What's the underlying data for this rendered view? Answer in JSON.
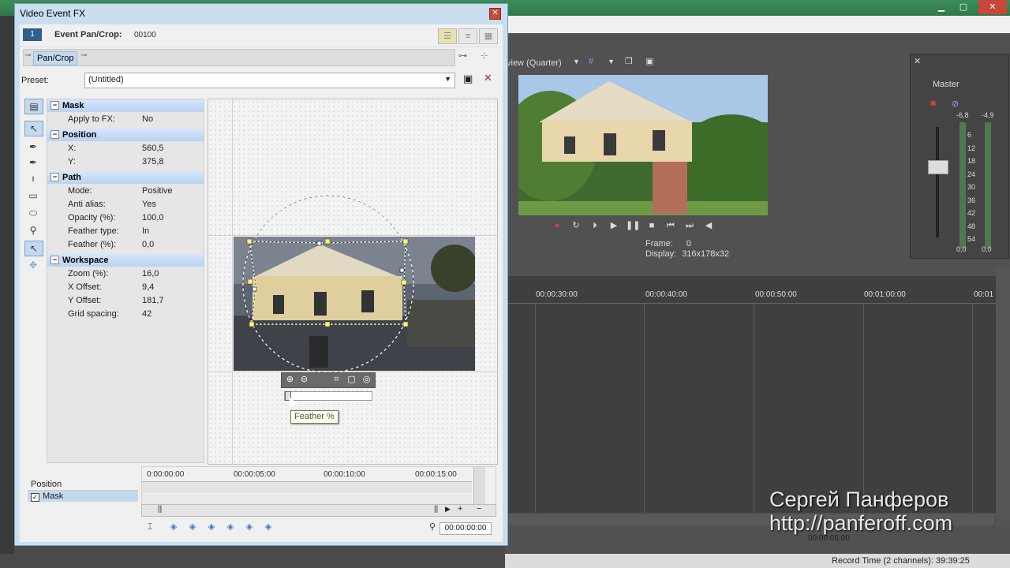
{
  "dialog": {
    "title": "Video Event FX",
    "fx": {
      "chip": "1",
      "name": "Event Pan/Crop:",
      "code": "00100"
    },
    "chain": {
      "item": "Pan/Crop"
    },
    "preset": {
      "label": "Preset:",
      "value": "(Untitled)"
    }
  },
  "properties": {
    "sections": [
      {
        "title": "Mask",
        "rows": [
          {
            "k": "Apply to FX:",
            "v": "No"
          }
        ]
      },
      {
        "title": "Position",
        "rows": [
          {
            "k": "X:",
            "v": "560,5"
          },
          {
            "k": "Y:",
            "v": "375,8"
          }
        ]
      },
      {
        "title": "Path",
        "rows": [
          {
            "k": "Mode:",
            "v": "Positive"
          },
          {
            "k": "Anti alias:",
            "v": "Yes"
          },
          {
            "k": "Opacity (%):",
            "v": "100,0"
          },
          {
            "k": "Feather type:",
            "v": "In"
          },
          {
            "k": "Feather (%):",
            "v": "0,0"
          }
        ]
      },
      {
        "title": "Workspace",
        "rows": [
          {
            "k": "Zoom (%):",
            "v": "16,0"
          },
          {
            "k": "X Offset:",
            "v": "9,4"
          },
          {
            "k": "Y Offset:",
            "v": "181,7"
          },
          {
            "k": "Grid spacing:",
            "v": "42"
          }
        ]
      }
    ]
  },
  "workspace": {
    "tooltip": "Feather %",
    "feather_value": 0
  },
  "keyframes": {
    "tracks": [
      "Position",
      "Mask"
    ],
    "ruler": [
      "0:00:00:00",
      "00:00:05:00",
      "00:00:10:00",
      "00:00:15:00"
    ],
    "time": "00:00:00:00"
  },
  "host": {
    "preview_mode": "view (Quarter)",
    "frame_label": "Frame:",
    "frame_value": "0",
    "display_label": "Display:",
    "display_value": "316x178x32",
    "master_label": "Master",
    "meter_scale": [
      "6",
      "12",
      "18",
      "24",
      "30",
      "36",
      "42",
      "48",
      "54"
    ],
    "meter_peaks": [
      "-6,8",
      "-4,9"
    ],
    "meter_levels": [
      "0,0",
      "0,0"
    ],
    "timeline_ruler": [
      "00:00:30:00",
      "00:00:40:00",
      "00:00:50:00",
      "00:01:00:00",
      "00:01"
    ],
    "timeline_time": "00:00:05:00",
    "status": "Record Time (2 channels): 39:39:25",
    "watermark_name": "Сергей Панферов",
    "watermark_url": "http://panferoff.com"
  },
  "colors": {
    "accent": "#c5d9ee",
    "section_header": "#b9d3f2",
    "mask_line": "#ffffff",
    "handle": "#ffff66"
  },
  "icons": {
    "close": "close-icon",
    "save_preset": "save-icon",
    "delete_preset": "delete-icon"
  }
}
